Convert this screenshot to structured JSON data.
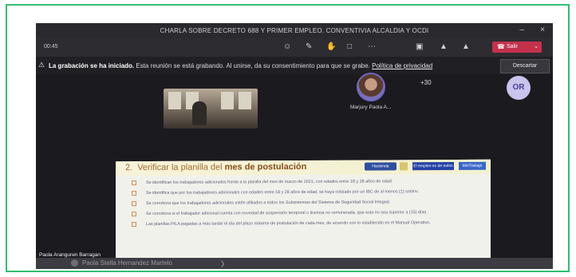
{
  "window": {
    "title": "CHARLA SOBRE DECRETO 688 Y PRIMER EMPLEO. CONVENTIVIA ALCALDIA Y OCDI",
    "minimize_glyph": "–",
    "close_glyph": "×"
  },
  "toolbar": {
    "timer": "00:45",
    "leave_label": "Salir",
    "icons": [
      "people-icon",
      "chat-icon",
      "raise-hand-icon",
      "rooms-icon",
      "more-icon",
      "camera-icon",
      "mic-icon",
      "share-icon"
    ]
  },
  "banner": {
    "bold": "La grabación se ha iniciado.",
    "message": "Esta reunión se está grabando. Al unirse, da su consentimiento para que se grabe.",
    "link": "Política de privacidad",
    "dismiss_label": "Descartar"
  },
  "participants": {
    "featured_name": "Marjury Paola A...",
    "overflow": "+30",
    "initials": "OR",
    "presenter": "Paola Aranguren Barragan",
    "bottom_name": "Paola Stella Hernandez Martelo"
  },
  "slide": {
    "number": "2.",
    "title_pre": "Verificar la planilla del",
    "title_bold": "mes de postulación",
    "logos": [
      "Hacienda",
      "El empleo es de todos",
      "MinTrabajo"
    ],
    "bullets": [
      "Se identifican los trabajadores adicionales frente a la planilla del mes de marzo de 2021, con edades entre 18 y 28 años de edad.",
      "Se identifica que por los trabajadores adicionales con edades entre 18 y 28 años de edad, se haya cotizado por un IBC de al menos (1) smlmv.",
      "Se corrobora que los trabajadores adicionales estén afiliados a todos los Subsistemas del Sistema de Seguridad Social Integral.",
      "Se corrobora si el trabajador adicional cuenta con novedad de suspensión temporal o licencia no remunerada, que esta no sea superior a (15) días.",
      "Las planillas PILA pagadas a más tardar el día del plazo máximo de postulación de cada mes, de acuerdo con lo establecido en el Manual Operativo."
    ]
  },
  "colors": {
    "frame_border": "#2fbf71",
    "leave_button": "#c4314b",
    "slide_title": "#a36b30"
  }
}
